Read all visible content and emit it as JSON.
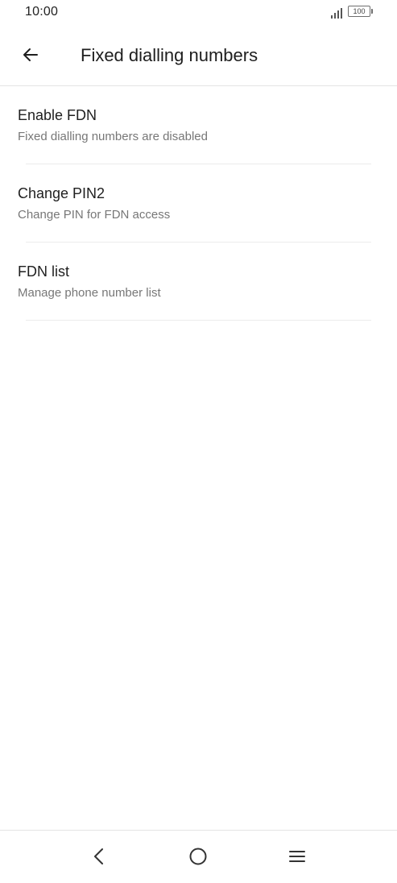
{
  "status_bar": {
    "time": "10:00",
    "battery_level": "100",
    "icons": [
      "signal-icon",
      "battery-icon"
    ]
  },
  "app_bar": {
    "back_icon": "arrow-left-icon",
    "title": "Fixed dialling numbers"
  },
  "settings": {
    "items": [
      {
        "title": "Enable FDN",
        "summary": "Fixed dialling numbers are disabled"
      },
      {
        "title": "Change PIN2",
        "summary": "Change PIN for FDN access"
      },
      {
        "title": "FDN list",
        "summary": "Manage phone number list"
      }
    ]
  },
  "nav_bar": {
    "icons": [
      "nav-back-icon",
      "nav-home-icon",
      "nav-recents-icon"
    ]
  },
  "colors": {
    "background": "#ffffff",
    "primary_text": "#1f1f1f",
    "secondary_text": "#777777",
    "divider": "#ececec"
  }
}
